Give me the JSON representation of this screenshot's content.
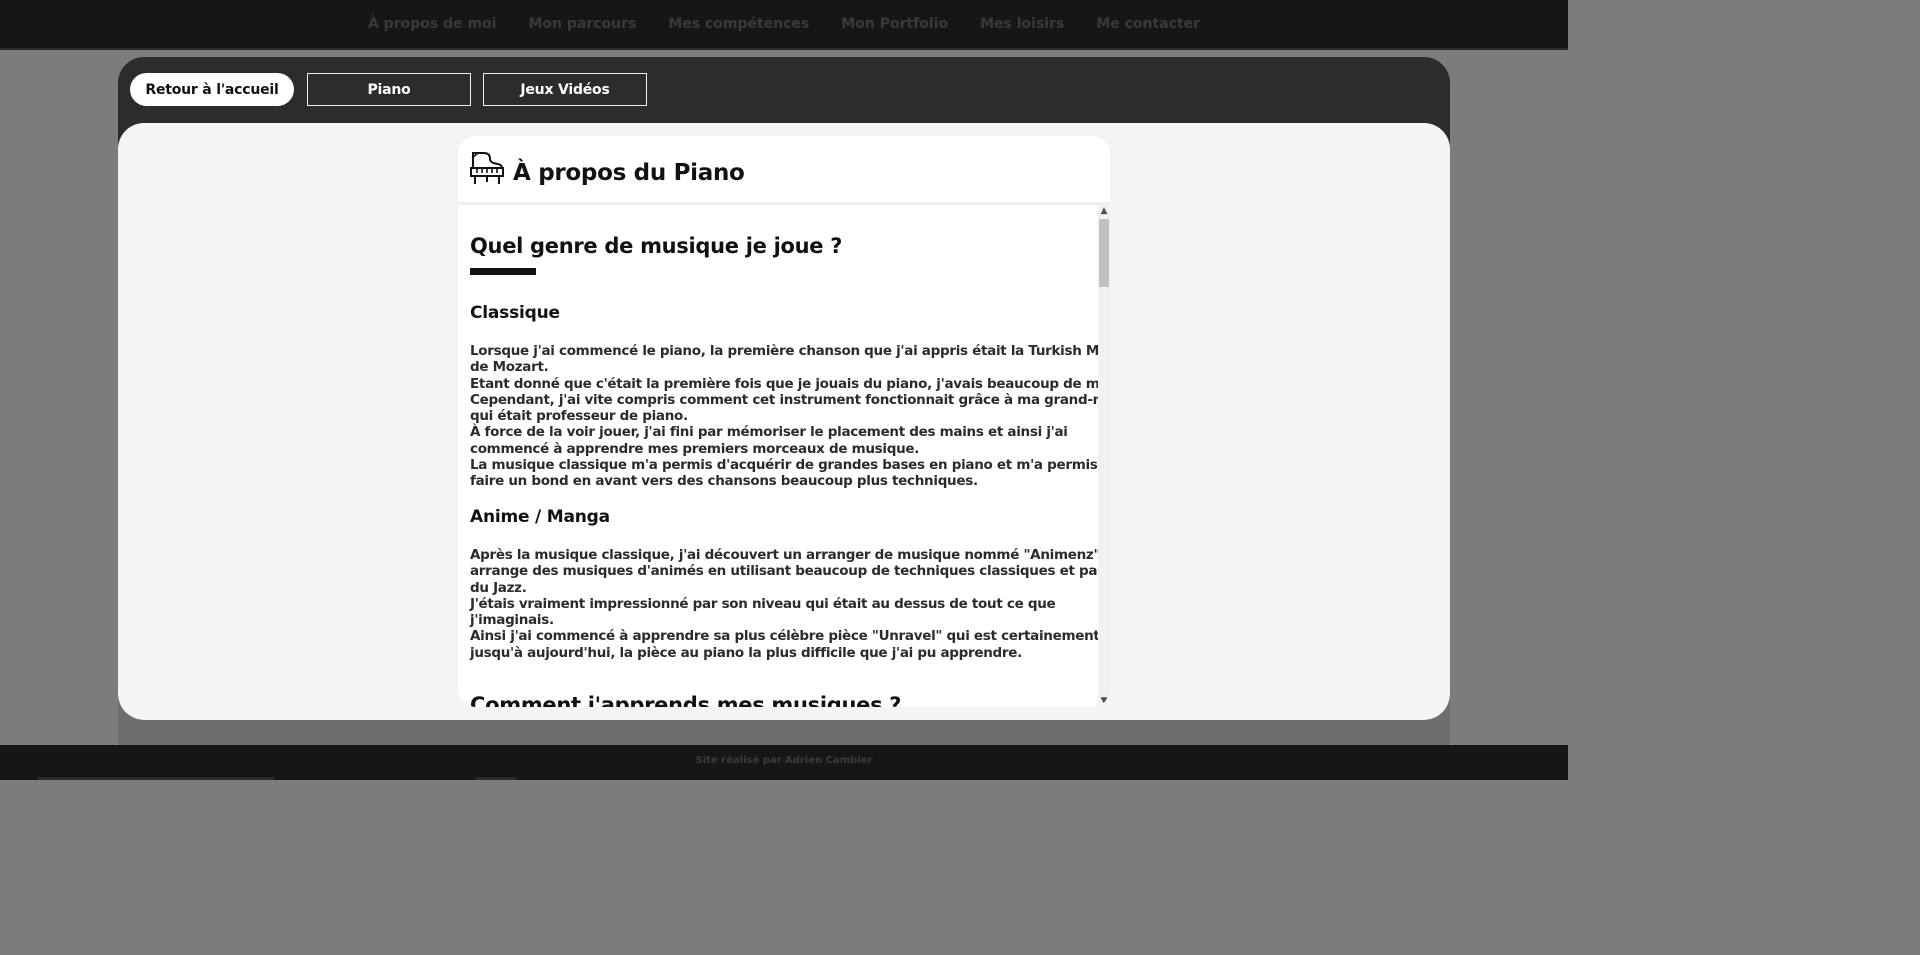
{
  "nav": {
    "items": [
      "À propos de moi",
      "Mon parcours",
      "Mes compétences",
      "Mon Portfolio",
      "Mes loisirs",
      "Me contacter"
    ]
  },
  "tabs": {
    "home": "Retour à l'accueil",
    "piano": "Piano",
    "games": "Jeux Vidéos"
  },
  "card": {
    "title": "À propos du Piano",
    "icon": "piano-icon",
    "section1_title": "Quel genre de musique je joue ?",
    "classique": {
      "title": "Classique",
      "lines": [
        "Lorsque j'ai commencé le piano, la première chanson que j'ai appris était la Turkish March",
        "de Mozart.",
        "Etant donné que c'était la première fois que je jouais du piano, j'avais beaucoup de mal.",
        "Cependant, j'ai vite compris comment cet instrument fonctionnait grâce à ma grand-mère",
        "qui était professeur de piano.",
        "À force de la voir jouer, j'ai fini par mémoriser le placement des mains et ainsi j'ai",
        "commencé à apprendre mes premiers morceaux de musique.",
        "La musique classique m'a permis d'acquérir de grandes bases en piano et m'a permis de",
        "faire un bond en avant vers des chansons beaucoup plus techniques."
      ]
    },
    "anime": {
      "title": "Anime / Manga",
      "lines": [
        "Après la musique classique, j'ai découvert un arranger de musique nommé \"Animenz\" qui",
        "arrange des musiques d'animés en utilisant beaucoup de techniques classiques et parfois",
        "du Jazz.",
        "J'étais vraiment impressionné par son niveau qui était au dessus de tout ce que",
        "j'imaginais.",
        "Ainsi j'ai commencé à apprendre sa plus célèbre pièce \"Unravel\" qui est certainement",
        "jusqu'à aujourd'hui, la pièce au piano la plus difficile que j'ai pu apprendre."
      ]
    },
    "section2_title": "Comment j'apprends mes musiques ?"
  },
  "footer": {
    "credit": "Site réalisé par Adrien Cambier"
  },
  "colors": {
    "nav_bg": "#161616",
    "modal_bg": "#2c2c2c",
    "body_bg": "#f4f4f4",
    "accent": "#111111"
  }
}
